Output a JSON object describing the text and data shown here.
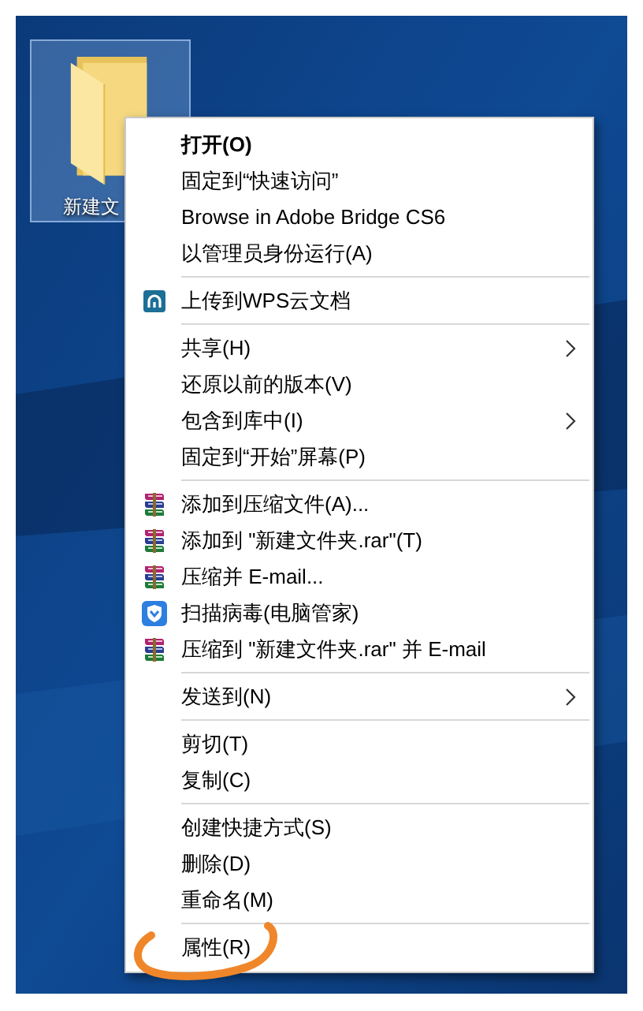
{
  "desktop": {
    "folder": {
      "label": "新建文",
      "selected": true
    }
  },
  "context_menu": {
    "items": [
      {
        "kind": "plain",
        "label": "打开(O)",
        "default": true,
        "submenu": false,
        "circled": false
      },
      {
        "kind": "plain",
        "label": "固定到“快速访问”",
        "default": false,
        "submenu": false,
        "circled": false
      },
      {
        "kind": "plain",
        "label": "Browse in Adobe Bridge CS6",
        "default": false,
        "submenu": false,
        "circled": false
      },
      {
        "kind": "plain",
        "label": "以管理员身份运行(A)",
        "default": false,
        "submenu": false,
        "circled": false
      },
      {
        "kind": "separator"
      },
      {
        "kind": "cloud",
        "label": "上传到WPS云文档",
        "default": false,
        "submenu": false,
        "circled": false
      },
      {
        "kind": "separator"
      },
      {
        "kind": "plain",
        "label": "共享(H)",
        "default": false,
        "submenu": true,
        "circled": false
      },
      {
        "kind": "plain",
        "label": "还原以前的版本(V)",
        "default": false,
        "submenu": false,
        "circled": false
      },
      {
        "kind": "plain",
        "label": "包含到库中(I)",
        "default": false,
        "submenu": true,
        "circled": false
      },
      {
        "kind": "plain",
        "label": "固定到“开始”屏幕(P)",
        "default": false,
        "submenu": false,
        "circled": false
      },
      {
        "kind": "separator"
      },
      {
        "kind": "archive",
        "label": "添加到压缩文件(A)...",
        "default": false,
        "submenu": false,
        "circled": false
      },
      {
        "kind": "archive",
        "label": "添加到 \"新建文件夹.rar\"(T)",
        "default": false,
        "submenu": false,
        "circled": false
      },
      {
        "kind": "archive",
        "label": "压缩并 E-mail...",
        "default": false,
        "submenu": false,
        "circled": false
      },
      {
        "kind": "shield",
        "label": "扫描病毒(电脑管家)",
        "default": false,
        "submenu": false,
        "circled": false
      },
      {
        "kind": "archive",
        "label": "压缩到 \"新建文件夹.rar\" 并 E-mail",
        "default": false,
        "submenu": false,
        "circled": false
      },
      {
        "kind": "separator"
      },
      {
        "kind": "plain",
        "label": "发送到(N)",
        "default": false,
        "submenu": true,
        "circled": false
      },
      {
        "kind": "separator"
      },
      {
        "kind": "plain",
        "label": "剪切(T)",
        "default": false,
        "submenu": false,
        "circled": false
      },
      {
        "kind": "plain",
        "label": "复制(C)",
        "default": false,
        "submenu": false,
        "circled": false
      },
      {
        "kind": "separator"
      },
      {
        "kind": "plain",
        "label": "创建快捷方式(S)",
        "default": false,
        "submenu": false,
        "circled": false
      },
      {
        "kind": "plain",
        "label": "删除(D)",
        "default": false,
        "submenu": false,
        "circled": false
      },
      {
        "kind": "plain",
        "label": "重命名(M)",
        "default": false,
        "submenu": false,
        "circled": false
      },
      {
        "kind": "separator"
      },
      {
        "kind": "plain",
        "label": "属性(R)",
        "default": false,
        "submenu": false,
        "circled": true
      }
    ]
  }
}
